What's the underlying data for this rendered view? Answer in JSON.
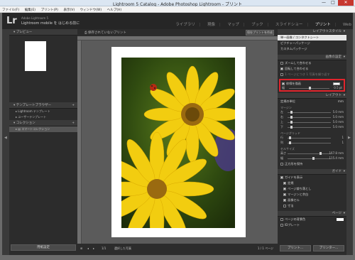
{
  "window": {
    "title": "Lightroom 5 Catalog - Adobe Photoshop Lightroom - プリント",
    "min": "—",
    "max": "□",
    "close": "✕"
  },
  "menu": [
    "ファイル(F)",
    "編集(E)",
    "プリント(P)",
    "表示(V)",
    "ウィンドウ(W)",
    "ヘルプ(H)"
  ],
  "identity": {
    "logo": "Lr",
    "line1": "Adobe Lightroom 5",
    "line2": "Lightroom mobile を はじめる前に"
  },
  "modules": [
    "ライブラリ",
    "現像",
    "マップ",
    "ブック",
    "スライドショー",
    "プリント",
    "Web"
  ],
  "active_module": "プリント",
  "left": {
    "preview_title": "プレビュー",
    "template_browser_title": "テンプレートブラウザー",
    "template_items": [
      "Lightroom テンプレート",
      "ユーザーテンプレート"
    ],
    "collections_title": "コレクション",
    "collection_items": [
      "スマートコレクション"
    ],
    "print_settings_button": "用紙設定"
  },
  "center": {
    "unsaved_label": "保存されていないプリント",
    "create_button": "保存プリントを作成",
    "bottom_items": [
      "⊞",
      "◂",
      "▸",
      "1/1",
      "選択した写真"
    ],
    "page_indicator": "1 / 1 ページ"
  },
  "right": {
    "layout_style_title": "レイアウトスタイル",
    "layout_items": [
      "単一画像 / コンタクトシート",
      "ピクチャーパッケージ",
      "カスタムパッケージ"
    ],
    "image_settings_title": "画像の設定",
    "options": [
      {
        "label": "ズームして合わせる",
        "checked": false
      },
      {
        "label": "回転して合わせる",
        "checked": true
      },
      {
        "label": "1 ページにつき 1 写真を繰り返す",
        "checked": false
      }
    ],
    "stroke_border_label": "枠線を描画",
    "stroke_border_checked": true,
    "stroke_width_label": "幅",
    "stroke_width_value": "0.5 pt",
    "layout_title": "レイアウト",
    "ruler_units_label": "定規の単位",
    "ruler_units_value": "mm",
    "margins_title": "マージン",
    "margin_labels": [
      "左",
      "右",
      "上",
      "下"
    ],
    "margin_values": [
      "5.0 mm",
      "5.0 mm",
      "5.0 mm",
      "5.0 mm"
    ],
    "page_grid_title": "ページグリッド",
    "page_grid_labels": [
      "行",
      "列"
    ],
    "page_grid_values": [
      "1",
      "1"
    ],
    "cell_size_title": "セルサイズ",
    "cell_size_labels": [
      "高さ",
      "幅"
    ],
    "cell_size_values": [
      "167.8 mm",
      "115.4 mm"
    ],
    "keep_square_label": "正方形を保持",
    "guides_title": "ガイド",
    "show_guides_label": "ガイドを表示",
    "guide_items": [
      {
        "label": "定規",
        "checked": true
      },
      {
        "label": "ページ裁ち落とし",
        "checked": true
      },
      {
        "label": "マージンと余白",
        "checked": true
      },
      {
        "label": "画像セル",
        "checked": true
      },
      {
        "label": "寸法",
        "checked": false
      }
    ],
    "page_title": "ページ",
    "page_bg_label": "ページの背景色",
    "id_plate_label": "IDプレート",
    "print_button": "プリント...",
    "printer_button": "プリンター..."
  },
  "colors": {
    "highlight": "#e0242c",
    "panel": "#2c2c2c",
    "canvas": "#5b5b5b"
  }
}
